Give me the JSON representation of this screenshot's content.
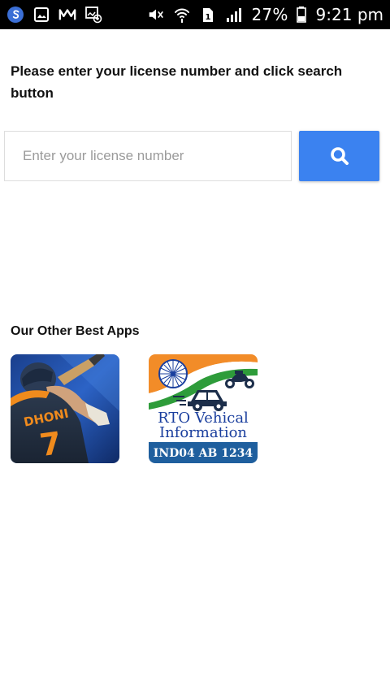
{
  "status_bar": {
    "left_icons": [
      "s-app-icon",
      "gallery-icon",
      "gmail-icon",
      "image-notification-icon"
    ],
    "right_icons": [
      "mute-icon",
      "wifi-icon",
      "sim-icon",
      "signal-icon"
    ],
    "battery": "27%",
    "time": "9:21 pm"
  },
  "form": {
    "instructions": "Please enter your license number and click search button",
    "placeholder": "Enter your license number",
    "search_icon": "search-icon",
    "accent_color": "#3b82f0"
  },
  "other_apps": {
    "title": "Our Other Best Apps",
    "apps": [
      {
        "jersey_text": "DHONI",
        "jersey_number": "7"
      },
      {
        "line1": "RTO Vehical",
        "line2": "Information",
        "plate": "IND04 AB 1234"
      }
    ]
  }
}
